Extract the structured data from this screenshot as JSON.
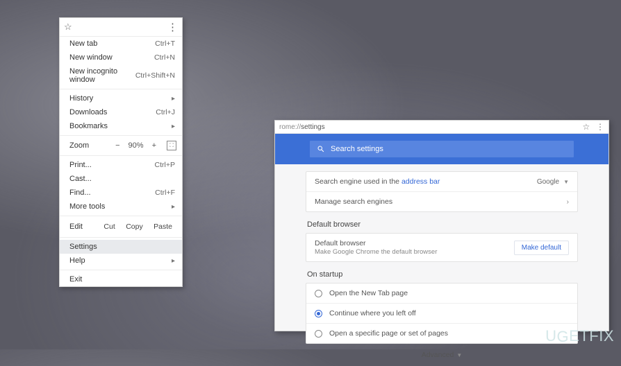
{
  "menu": {
    "items_block1": [
      {
        "label": "New tab",
        "shortcut": "Ctrl+T"
      },
      {
        "label": "New window",
        "shortcut": "Ctrl+N"
      },
      {
        "label": "New incognito window",
        "shortcut": "Ctrl+Shift+N"
      }
    ],
    "items_block2": [
      {
        "label": "History",
        "has_sub": true
      },
      {
        "label": "Downloads",
        "shortcut": "Ctrl+J"
      },
      {
        "label": "Bookmarks",
        "has_sub": true
      }
    ],
    "zoom": {
      "label": "Zoom",
      "minus": "−",
      "value": "90%",
      "plus": "+",
      "full_tooltip": "Full screen"
    },
    "items_block3": [
      {
        "label": "Print...",
        "shortcut": "Ctrl+P"
      },
      {
        "label": "Cast..."
      },
      {
        "label": "Find...",
        "shortcut": "Ctrl+F"
      },
      {
        "label": "More tools",
        "has_sub": true
      }
    ],
    "edit": {
      "label": "Edit",
      "cut": "Cut",
      "copy": "Copy",
      "paste": "Paste"
    },
    "items_block4": [
      {
        "label": "Settings",
        "highlight": true
      },
      {
        "label": "Help",
        "has_sub": true
      }
    ],
    "items_block5": [
      {
        "label": "Exit"
      }
    ]
  },
  "settings_window": {
    "address_prefix": "rome://",
    "address_path": "settings",
    "search_placeholder": "Search settings",
    "search_engine_section": {
      "row1_text": "Search engine used in the ",
      "row1_link": "address bar",
      "row1_value": "Google",
      "row2_text": "Manage search engines"
    },
    "default_browser": {
      "title": "Default browser",
      "row_label": "Default browser",
      "row_sub": "Make Google Chrome the default browser",
      "button": "Make default"
    },
    "on_startup": {
      "title": "On startup",
      "opt1": "Open the New Tab page",
      "opt2": "Continue where you left off",
      "opt3": "Open a specific page or set of pages",
      "selected": 2
    },
    "advanced": "Advanced"
  },
  "watermark": "UGETFIX"
}
